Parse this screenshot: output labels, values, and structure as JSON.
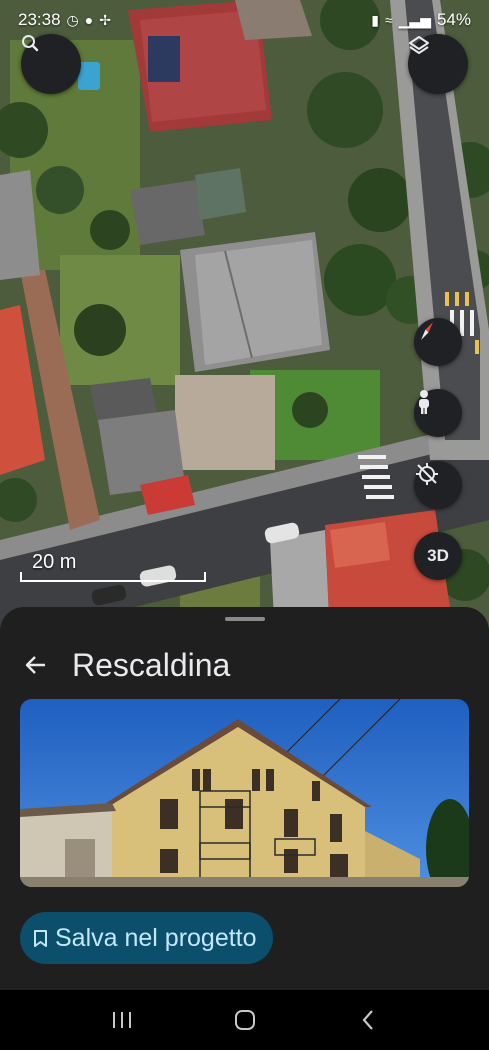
{
  "status_bar": {
    "time": "23:38",
    "battery": "54%",
    "left_icons": [
      "whatsapp-icon",
      "chat-icon",
      "slack-icon"
    ],
    "right_icons": [
      "battery-saver-icon",
      "wifi-icon",
      "signal-icon"
    ]
  },
  "map": {
    "scale_label": "20 m",
    "controls": {
      "search": "search-icon",
      "layers": "layers-icon",
      "compass": "compass-icon",
      "street_view": "pegman-icon",
      "location": "location-off-icon",
      "mode_3d": "3D"
    }
  },
  "place": {
    "title": "Rescaldina",
    "save_label": "Salva nel progetto"
  },
  "nav": {
    "buttons": [
      "recent-apps-icon",
      "home-icon",
      "back-icon"
    ]
  },
  "colors": {
    "sheet_bg": "#1f1f1f",
    "save_bg": "#0b4f6c",
    "save_text": "#c2e7ff",
    "compass_red": "#e8453c"
  }
}
